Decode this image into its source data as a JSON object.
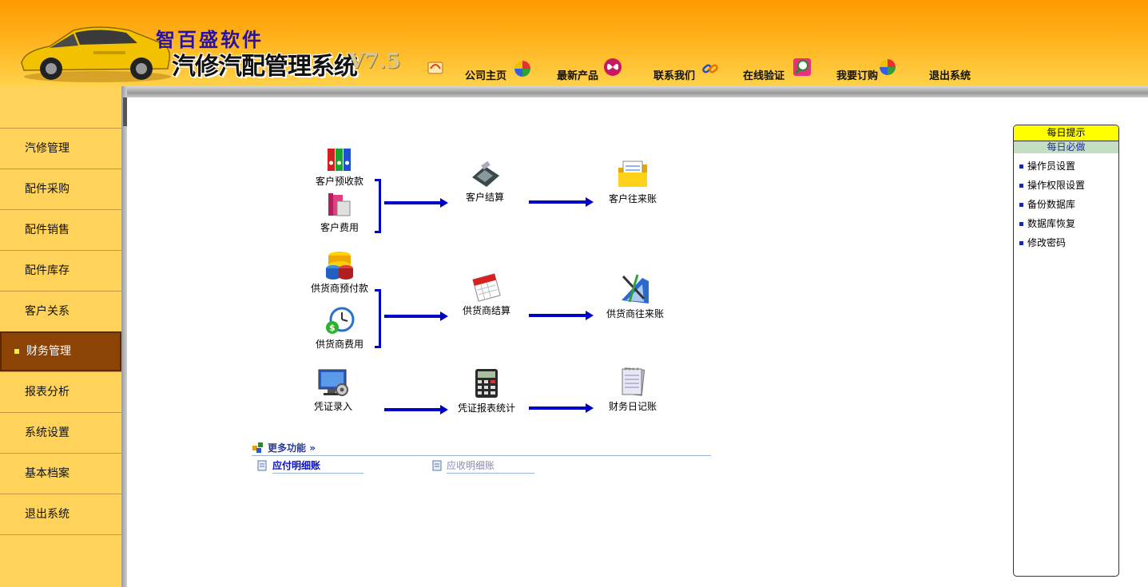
{
  "header": {
    "brand": "智百盛软件",
    "app_name": "汽修汽配管理系统",
    "version": "V7.5",
    "nav": [
      {
        "label": "公司主页"
      },
      {
        "label": "最新产品"
      },
      {
        "label": "联系我们"
      },
      {
        "label": "在线验证"
      },
      {
        "label": "我要订购"
      },
      {
        "label": "退出系统"
      }
    ]
  },
  "sidebar": {
    "items": [
      {
        "label": "汽修管理"
      },
      {
        "label": "配件采购"
      },
      {
        "label": "配件销售"
      },
      {
        "label": "配件库存"
      },
      {
        "label": "客户关系"
      },
      {
        "label": "财务管理",
        "active": true
      },
      {
        "label": "报表分析"
      },
      {
        "label": "系统设置"
      },
      {
        "label": "基本档案"
      },
      {
        "label": "退出系统"
      }
    ]
  },
  "flow": {
    "customer_advance": "客户预收款",
    "customer_fee": "客户费用",
    "customer_settle": "客户结算",
    "customer_account": "客户往来账",
    "supplier_advance": "供货商预付款",
    "supplier_fee": "供货商费用",
    "supplier_settle": "供货商结算",
    "supplier_account": "供货商往来账",
    "voucher_entry": "凭证录入",
    "voucher_report": "凭证报表统计",
    "journal": "财务日记账"
  },
  "more": {
    "title": "更多功能",
    "links": [
      {
        "label": "应付明细账"
      },
      {
        "label": "应收明细账"
      }
    ]
  },
  "tips": {
    "title": "每日提示",
    "subtitle": "每日必做",
    "items": [
      {
        "label": "操作员设置"
      },
      {
        "label": "操作权限设置"
      },
      {
        "label": "备份数据库"
      },
      {
        "label": "数据库恢复"
      },
      {
        "label": "修改密码"
      }
    ]
  },
  "colors": {
    "header_orange": "#ff9a00",
    "sidebar_yellow": "#ffd35a",
    "active_item": "#8b4306",
    "arrow_blue": "#0000c8",
    "tips_title": "#ffff00"
  }
}
